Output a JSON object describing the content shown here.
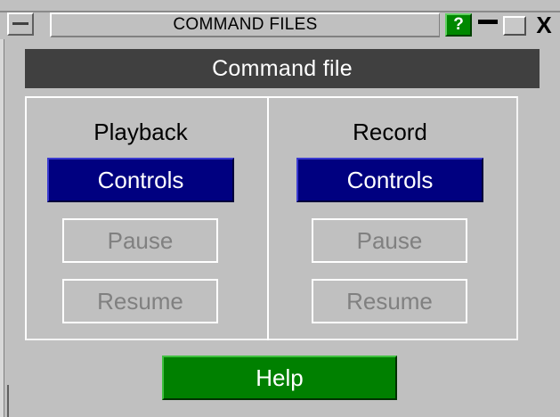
{
  "window": {
    "title": "COMMAND FILES",
    "help_icon": "?",
    "close_glyph": "X",
    "icons": [
      "system-menu-icon",
      "help-icon",
      "minimize-icon",
      "maximize-icon",
      "close-icon"
    ]
  },
  "header": {
    "title": "Command file"
  },
  "playback": {
    "label": "Playback",
    "controls_label": "Controls",
    "pause_label": "Pause",
    "resume_label": "Resume"
  },
  "record": {
    "label": "Record",
    "controls_label": "Controls",
    "pause_label": "Pause",
    "resume_label": "Resume"
  },
  "footer": {
    "help_label": "Help"
  },
  "colors": {
    "background": "#c0c0c0",
    "header_bg": "#404040",
    "controls_bg": "#000080",
    "help_bg": "#008000",
    "disabled_text": "#808080"
  }
}
